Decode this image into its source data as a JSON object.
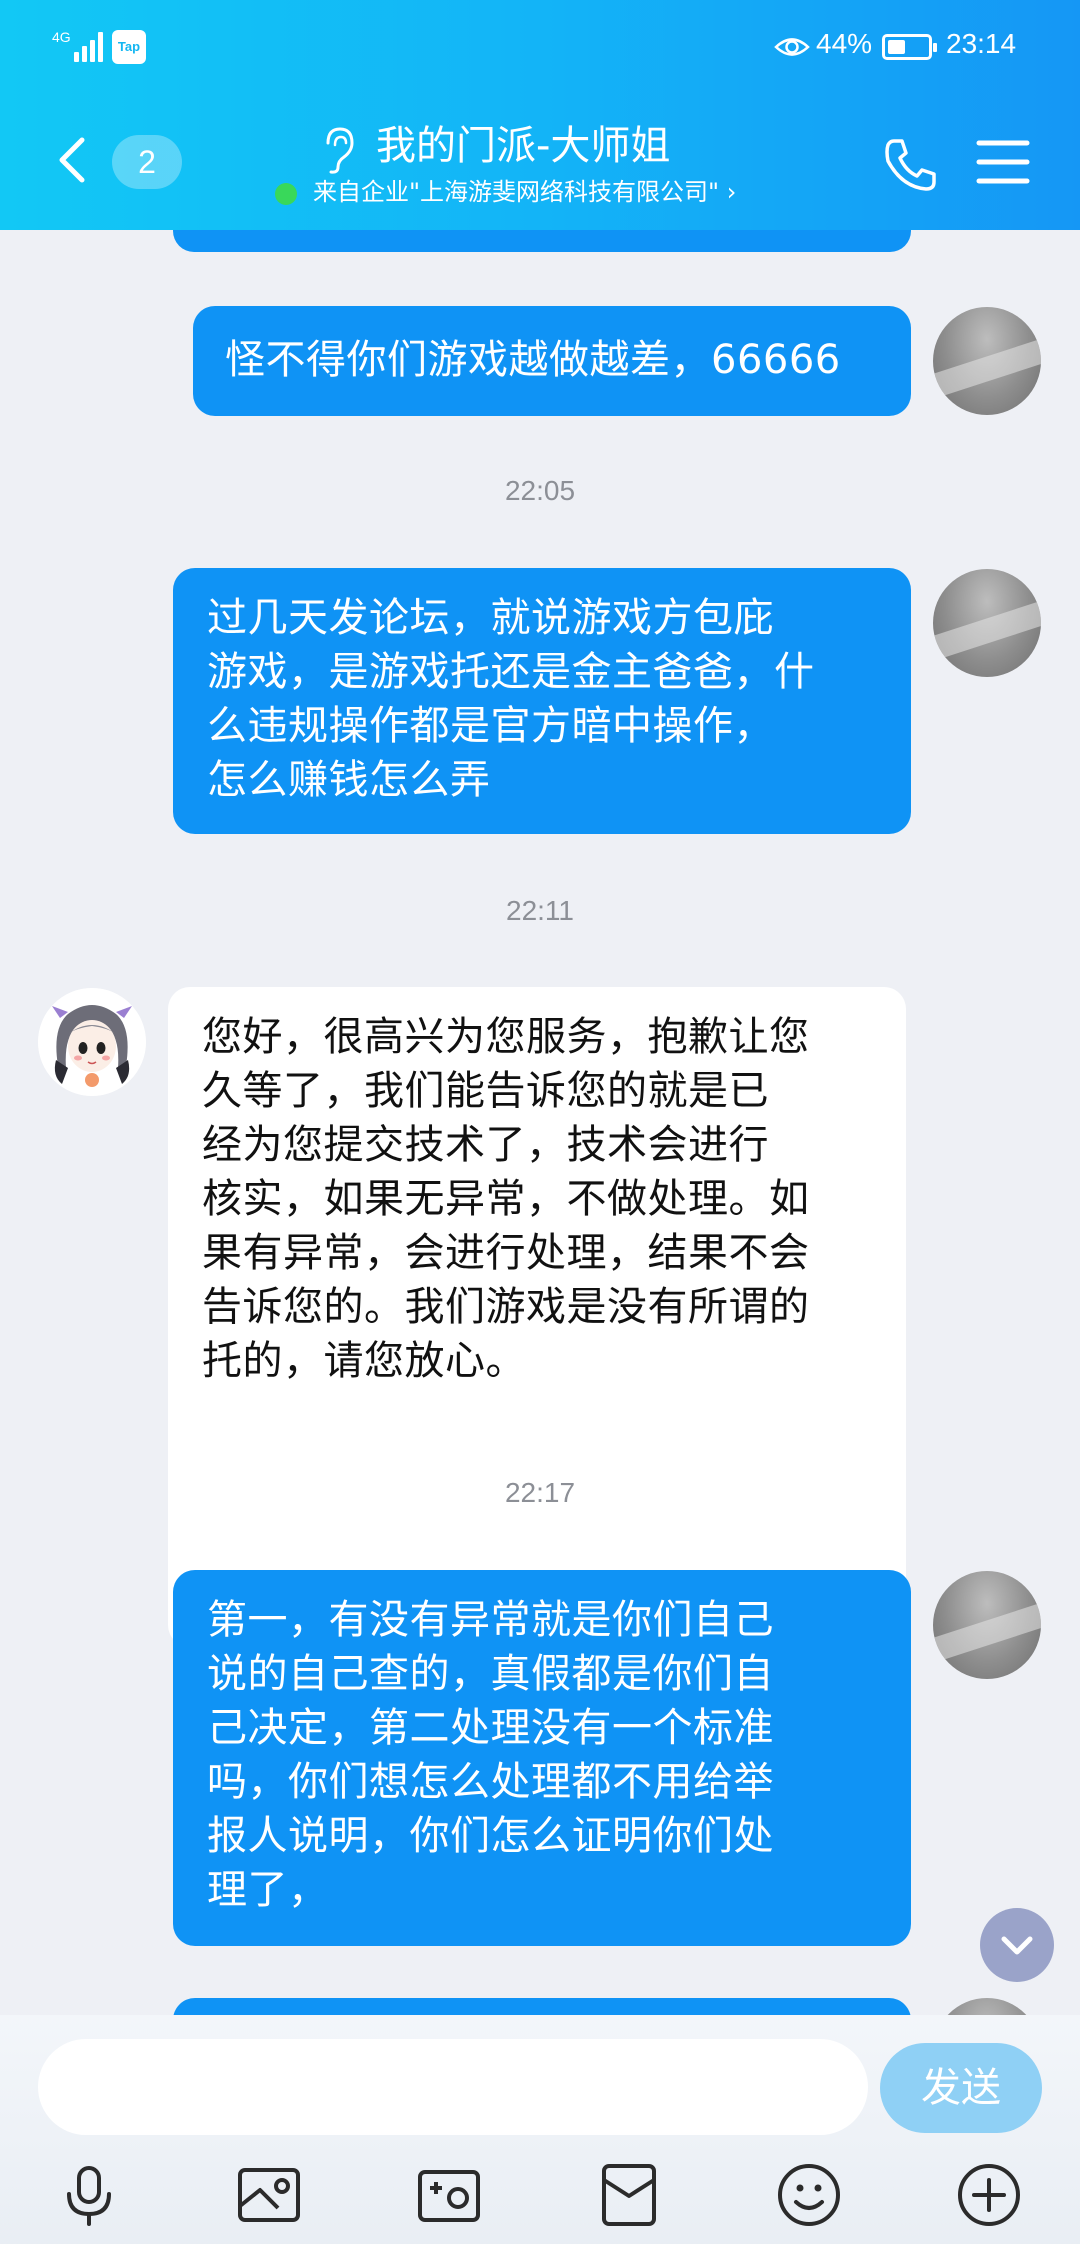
{
  "status_bar": {
    "network_label": "4G",
    "app_badge": "Tap",
    "battery_percent": "44%",
    "battery_level": 0.44,
    "time": "23:14"
  },
  "header": {
    "unread_count": "2",
    "title": "我的门派-大师姐",
    "subtitle": "来自企业\"上海游斐网络科技有限公司\" ›",
    "icons": [
      "chevron-left-icon",
      "ear-icon",
      "phone-icon",
      "menu-icon"
    ]
  },
  "messages": [
    {
      "type": "outgoing",
      "text": "怪不得你们游戏越做越差，66666"
    },
    {
      "type": "timestamp",
      "text": "22:05"
    },
    {
      "type": "outgoing",
      "lines": [
        "过几天发论坛，就说游戏方包庇",
        "游戏，是游戏托还是金主爸爸，什",
        "么违规操作都是官方暗中操作，",
        "怎么赚钱怎么弄"
      ]
    },
    {
      "type": "timestamp",
      "text": "22:11"
    },
    {
      "type": "incoming",
      "lines": [
        "您好，很高兴为您服务，抱歉让您",
        "久等了，我们能告诉您的就是已",
        "经为您提交技术了，技术会进行",
        "核实，如果无异常，不做处理。如",
        "果有异常，会进行处理，结果不会",
        "告诉您的。我们游戏是没有所谓的",
        "托的，请您放心。"
      ]
    },
    {
      "type": "timestamp",
      "text": "22:17"
    },
    {
      "type": "outgoing",
      "lines": [
        "第一，有没有异常就是你们自己",
        "说的自己查的，真假都是你们自",
        "己决定，第二处理没有一个标准",
        "吗，你们想怎么处理都不用给举",
        "报人说明，你们怎么证明你们处",
        "理了，"
      ]
    }
  ],
  "composer": {
    "input_value": "",
    "send_label": "发送",
    "tools": [
      "microphone-icon",
      "image-icon",
      "camera-icon",
      "red-packet-icon",
      "emoji-icon",
      "plus-icon"
    ]
  },
  "colors": {
    "header_gradient_start": "#12c8f5",
    "header_gradient_end": "#1597f5",
    "outgoing_bubble": "#0f93f5",
    "incoming_bubble": "#ffffff",
    "chat_background": "#eef0f5",
    "send_button": "#8fd0f5"
  }
}
